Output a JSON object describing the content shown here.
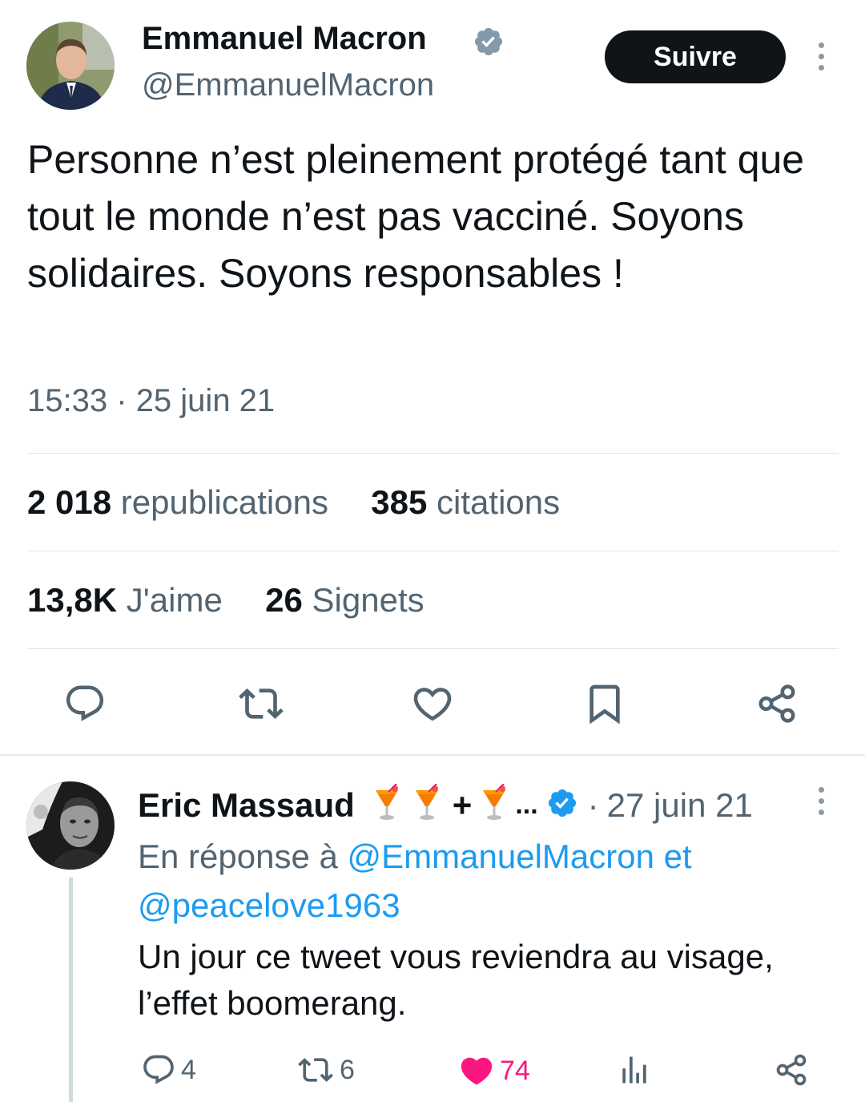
{
  "tweet": {
    "author_name": "Emmanuel Macron",
    "author_handle": "@EmmanuelMacron",
    "follow_label": "Suivre",
    "text": "Personne n’est pleinement protégé tant que tout le monde n’est pas vacciné. Soyons solidaires. Soyons responsables !",
    "time": "15:33",
    "separator": "·",
    "date": "25 juin 21",
    "stats": {
      "reposts_count": "2 018",
      "reposts_label": "republications",
      "quotes_count": "385",
      "quotes_label": "citations",
      "likes_count": "13,8K",
      "likes_label": "J'aime",
      "bookmarks_count": "26",
      "bookmarks_label": "Signets"
    }
  },
  "reply": {
    "author_name": "Eric Massaud",
    "name_suffix_plus": "+",
    "name_suffix_ellipsis": "...",
    "separator": "·",
    "date": "27 juin 21",
    "in_reply_prefix": "En réponse à",
    "mention_1": "@EmmanuelMacron",
    "and_word": "et",
    "mention_2": "@peacelove1963",
    "text": "Un jour ce tweet vous reviendra au visage, l’effet boomerang.",
    "replies_count": "4",
    "reposts_count": "6",
    "likes_count": "74"
  },
  "colors": {
    "text_primary": "#0f1419",
    "text_secondary": "#536471",
    "link": "#1d9bf0",
    "like_active": "#f91880",
    "verified_gray": "#829aab",
    "verified_blue": "#1d9bf0"
  },
  "icons": {
    "verified_gray": "verified-badge-icon",
    "verified_blue": "verified-badge-icon",
    "reply": "speech-bubble-icon",
    "repost": "repost-arrows-icon",
    "like": "heart-icon",
    "bookmark": "bookmark-icon",
    "share": "share-icon",
    "views": "bar-chart-icon",
    "more": "more-vertical-icon",
    "drink_emoji": "tropical-drink-emoji"
  }
}
